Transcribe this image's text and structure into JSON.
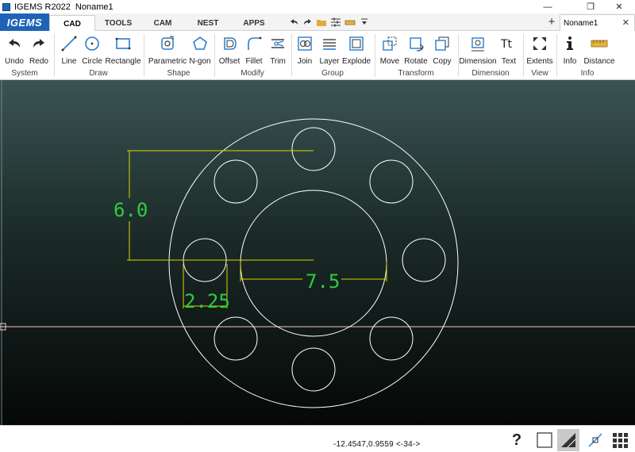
{
  "window": {
    "app_name": "IGEMS R2022",
    "doc_name": "Noname1",
    "minimize": "—",
    "restore": "❐",
    "close": "✕"
  },
  "tabs": {
    "logo": "IGEMS",
    "items": [
      "CAD",
      "TOOLS",
      "CAM",
      "NEST",
      "APPS"
    ],
    "active": "CAD",
    "doc_tab": "Noname1",
    "add": "+",
    "close": "✕"
  },
  "ribbon": {
    "groups": [
      {
        "label": "System",
        "buttons": [
          "Undo",
          "Redo"
        ]
      },
      {
        "label": "Draw",
        "buttons": [
          "Line",
          "Circle",
          "Rectangle"
        ]
      },
      {
        "label": "Shape",
        "buttons": [
          "Parametric",
          "N-gon"
        ]
      },
      {
        "label": "Modify",
        "buttons": [
          "Offset",
          "Fillet",
          "Trim"
        ]
      },
      {
        "label": "Group",
        "buttons": [
          "Join",
          "Layer",
          "Explode"
        ]
      },
      {
        "label": "Transform",
        "buttons": [
          "Move",
          "Rotate",
          "Copy"
        ]
      },
      {
        "label": "Dimension",
        "buttons": [
          "Dimension",
          "Text"
        ]
      },
      {
        "label": "View",
        "buttons": [
          "Extents"
        ]
      },
      {
        "label": "Info",
        "buttons": [
          "Info",
          "Distance"
        ]
      }
    ]
  },
  "drawing": {
    "dimensions": [
      "6.0",
      "7.5",
      "2.25"
    ],
    "colors": {
      "geometry": "#ffffff",
      "dimension_line": "#d6d600",
      "dimension_text": "#2ecc40",
      "axis": "#f0c8d0"
    }
  },
  "status": {
    "coords": "-12.4547,0.9559 <-34->",
    "help": "?"
  }
}
